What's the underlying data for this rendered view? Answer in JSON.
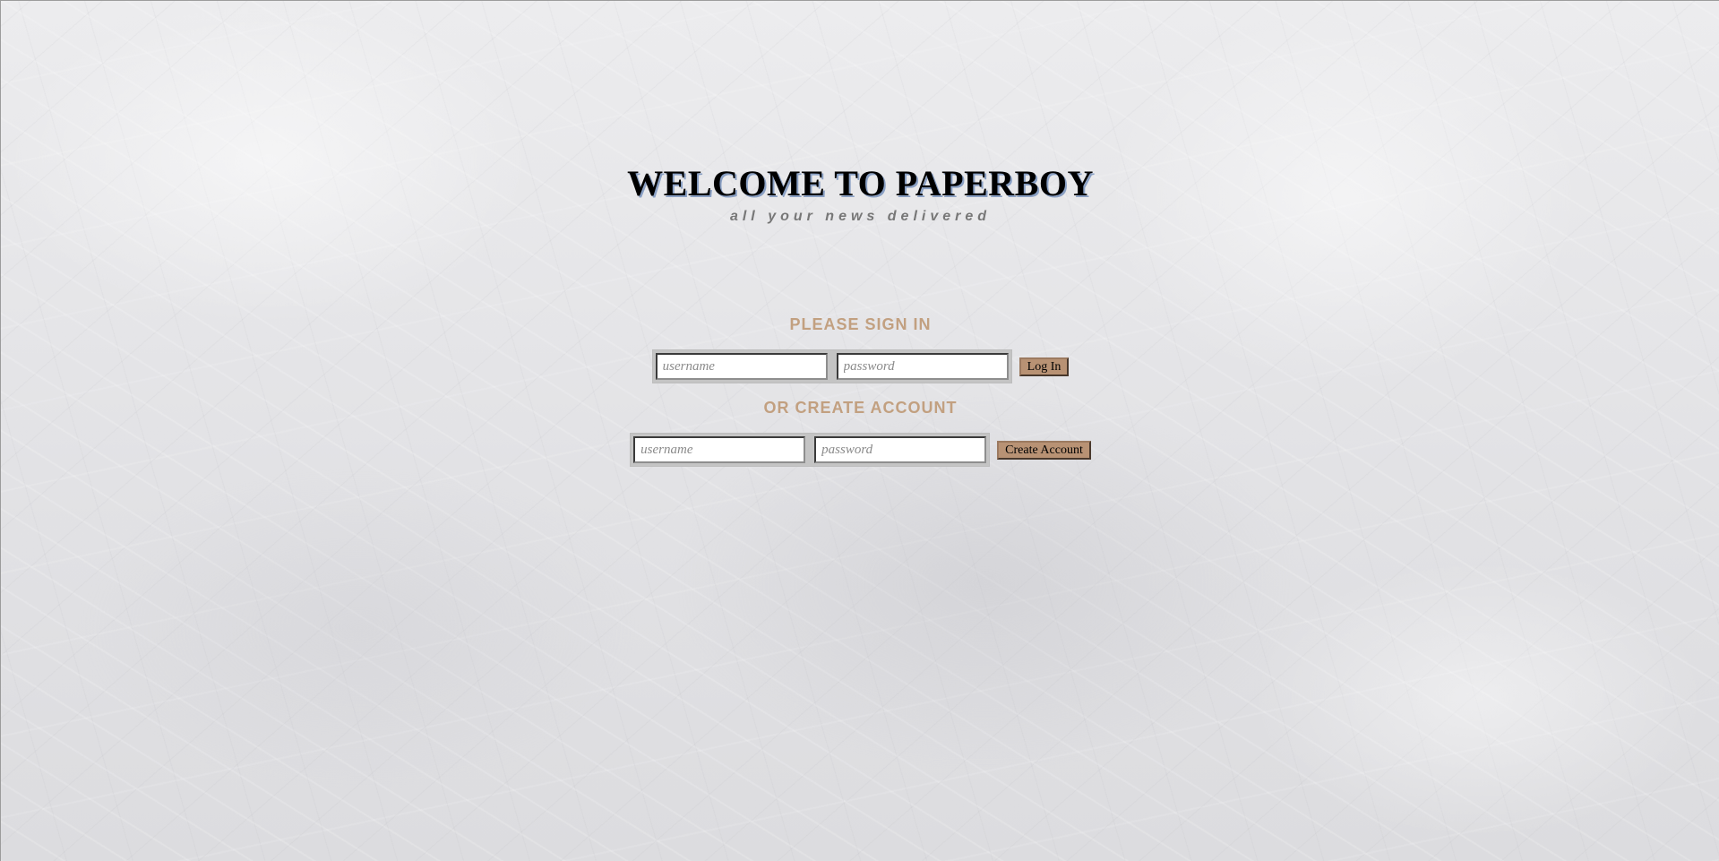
{
  "header": {
    "title": "WELCOME TO PAPERBOY",
    "subtitle": "all your news delivered"
  },
  "sign_in": {
    "heading": "PLEASE SIGN IN",
    "username_placeholder": "username",
    "password_placeholder": "password",
    "submit_label": "Log In"
  },
  "create_account": {
    "heading": "OR CREATE ACCOUNT",
    "username_placeholder": "username",
    "password_placeholder": "password",
    "submit_label": "Create Account"
  },
  "colors": {
    "heading_accent": "#c2a080",
    "button_fill": "#b89274",
    "title_shadow": "#8aa0c4"
  }
}
